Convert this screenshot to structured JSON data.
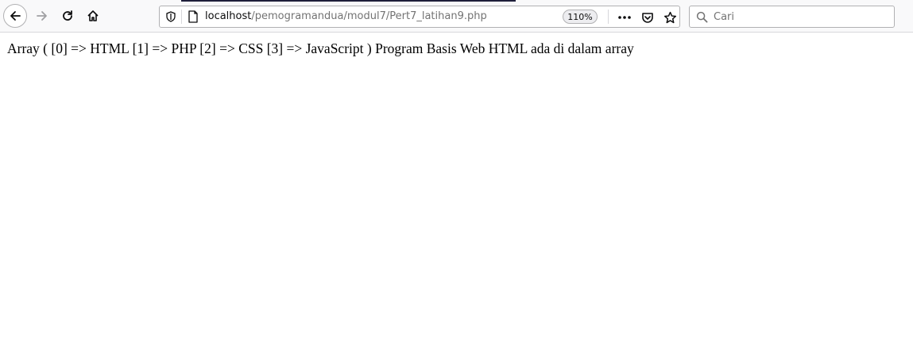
{
  "browser": {
    "url_host": "localhost",
    "url_path": "/pemogramandua/modul7/Pert7_latihan9.php",
    "zoom": "110%",
    "search": {
      "placeholder": "Cari"
    },
    "icons": {
      "back": "back-arrow-icon",
      "forward": "forward-arrow-icon",
      "reload": "reload-icon",
      "home": "home-icon",
      "tracking_protection": "shield-icon",
      "page_info": "page-icon",
      "more": "ellipsis-icon",
      "pocket": "pocket-icon",
      "bookmark": "star-icon",
      "search": "search-icon"
    }
  },
  "page": {
    "output_text": "Array ( [0] => HTML [1] => PHP [2] => CSS [3] => JavaScript ) Program Basis Web HTML ada di dalam array"
  }
}
